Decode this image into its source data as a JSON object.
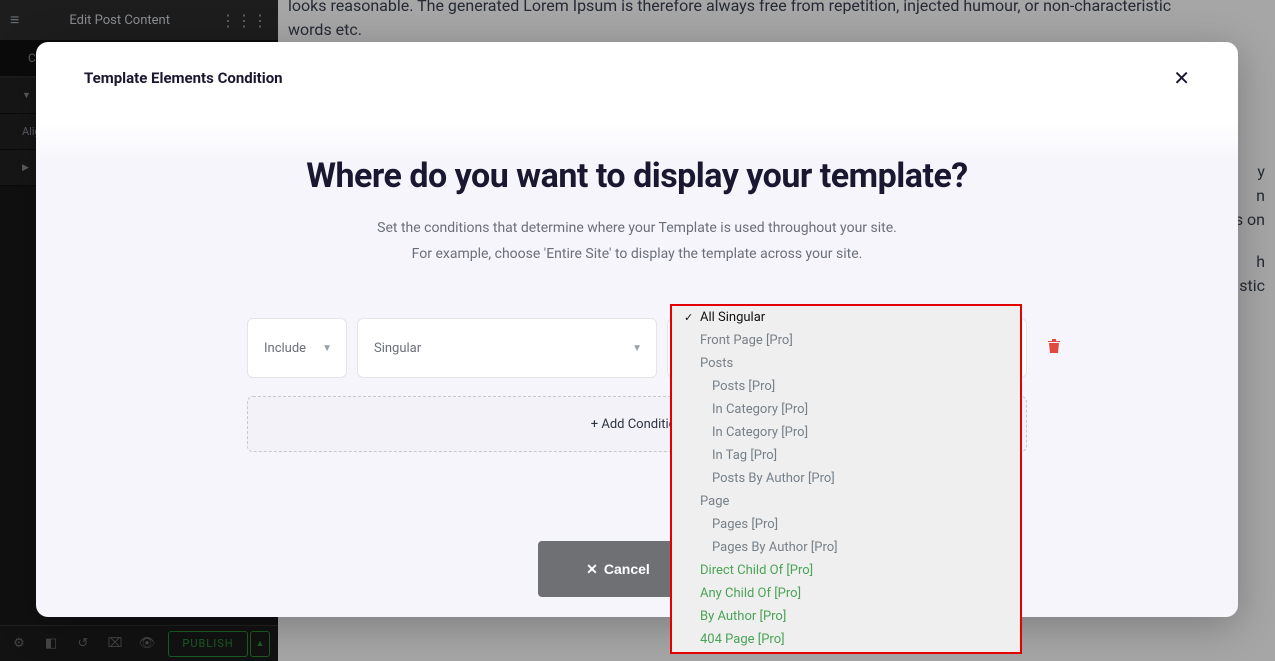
{
  "panel": {
    "title": "Edit Post Content",
    "tab": "Co",
    "align_label": "Alig"
  },
  "footer": {
    "publish": "PUBLISH"
  },
  "bg_text": {
    "p1_a": "looks reasonable. The generated Lorem Ipsum is therefore always free from repetition, injected humour, or non-characteristic",
    "p1_b": "words etc.",
    "p2_frag_a": "y",
    "p2_frag_b": "n",
    "p2_frag_c": "s on",
    "p3_frag_a": "h",
    "p3_frag_b": "stic"
  },
  "modal": {
    "title": "Template Elements Condition",
    "h1": "Where do you want to display your template?",
    "sub1": "Set the conditions that determine where your Template is used throughout your site.",
    "sub2": "For example, choose 'Entire Site' to display the template across your site.",
    "include_label": "Include",
    "singular_label": "Singular",
    "add_condition": "+ Add Condition",
    "cancel": "Cancel"
  },
  "dropdown": {
    "items": [
      {
        "label": "All Singular",
        "selected": true,
        "indent": 0,
        "green": false
      },
      {
        "label": "Front Page [Pro]",
        "selected": false,
        "indent": 1,
        "green": false
      },
      {
        "label": "Posts",
        "selected": false,
        "indent": 1,
        "green": false,
        "group": true
      },
      {
        "label": "Posts [Pro]",
        "selected": false,
        "indent": 2,
        "green": false
      },
      {
        "label": "In Category [Pro]",
        "selected": false,
        "indent": 2,
        "green": false
      },
      {
        "label": "In Category [Pro]",
        "selected": false,
        "indent": 2,
        "green": false
      },
      {
        "label": "In Tag [Pro]",
        "selected": false,
        "indent": 2,
        "green": false
      },
      {
        "label": "Posts By Author [Pro]",
        "selected": false,
        "indent": 2,
        "green": false
      },
      {
        "label": "Page",
        "selected": false,
        "indent": 1,
        "green": false,
        "group": true
      },
      {
        "label": "Pages [Pro]",
        "selected": false,
        "indent": 2,
        "green": false
      },
      {
        "label": "Pages By Author [Pro]",
        "selected": false,
        "indent": 2,
        "green": false
      },
      {
        "label": "Direct Child Of [Pro]",
        "selected": false,
        "indent": 1,
        "green": true
      },
      {
        "label": "Any Child Of [Pro]",
        "selected": false,
        "indent": 1,
        "green": true
      },
      {
        "label": "By Author [Pro]",
        "selected": false,
        "indent": 1,
        "green": true
      },
      {
        "label": "404 Page [Pro]",
        "selected": false,
        "indent": 1,
        "green": true
      }
    ]
  }
}
